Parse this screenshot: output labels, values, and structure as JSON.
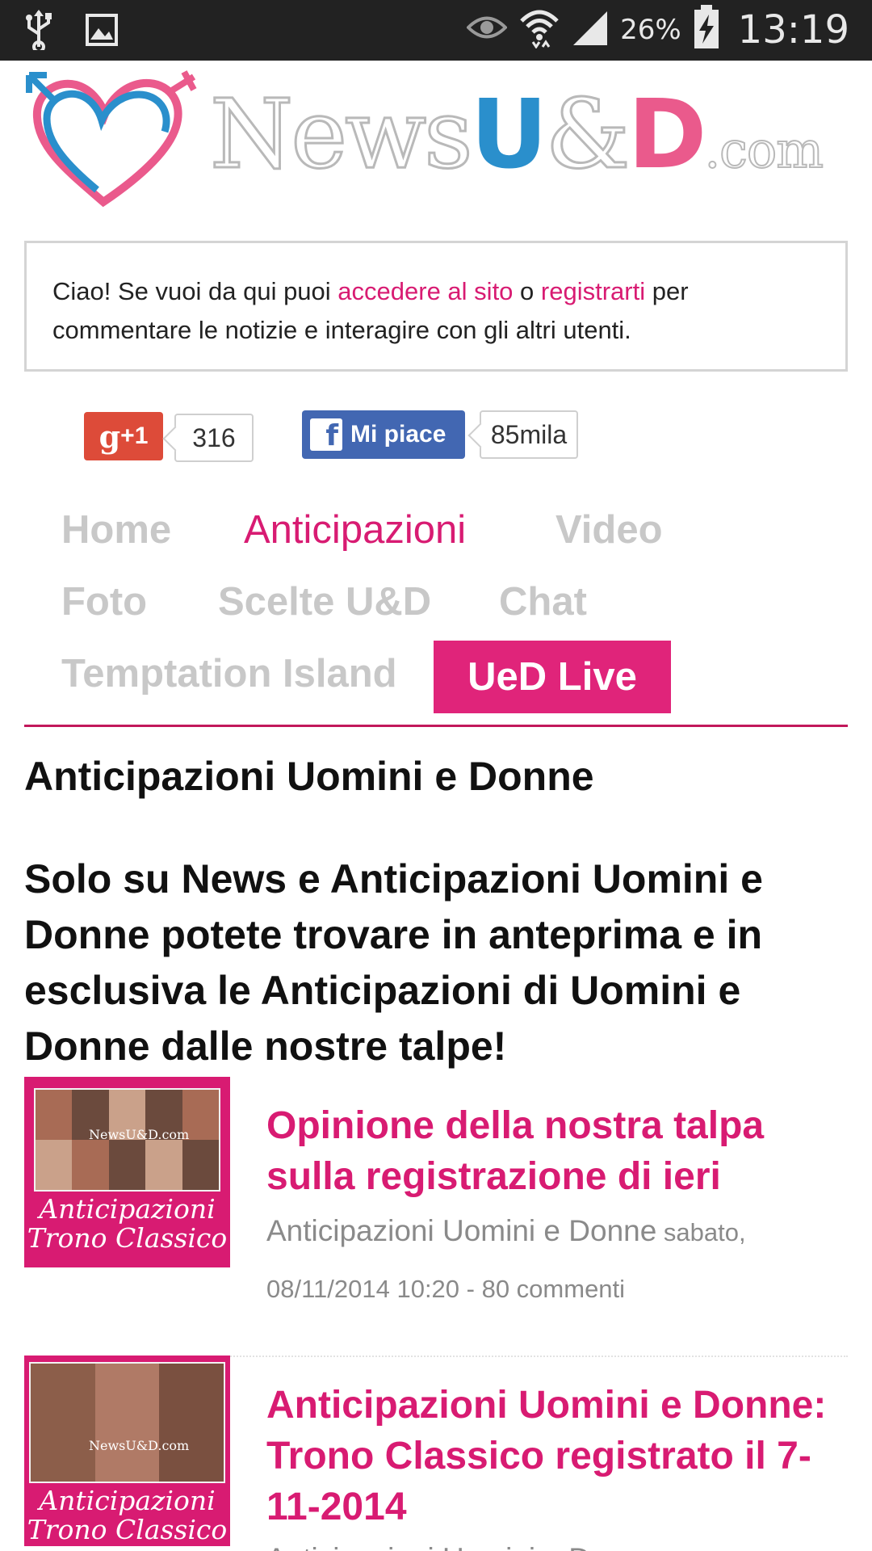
{
  "status_bar": {
    "battery_percent": "26%",
    "time": "13:19"
  },
  "logo": {
    "part_news": "News",
    "part_u": "U",
    "part_amp": "&",
    "part_d": "D",
    "part_com": ".com"
  },
  "notice": {
    "text_before": "Ciao! Se vuoi da qui puoi ",
    "login_link": "accedere al sito",
    "text_middle": " o ",
    "register_link": "registrarti",
    "text_after": " per commentare le notizie e interagire con gli altri utenti."
  },
  "social": {
    "gplus_label": "+1",
    "gplus_g": "g",
    "gplus_count": "316",
    "fb_label": "Mi piace",
    "fb_icon": "f",
    "fb_count": "85mila"
  },
  "nav": {
    "items": [
      {
        "label": "Home"
      },
      {
        "label": "Anticipazioni"
      },
      {
        "label": "Video"
      },
      {
        "label": "Foto"
      },
      {
        "label": "Scelte U&D"
      },
      {
        "label": "Chat"
      },
      {
        "label": "Temptation Island"
      },
      {
        "label": "UeD Live"
      }
    ],
    "active_index": 1
  },
  "page": {
    "title": "Anticipazioni Uomini e Donne",
    "intro": "Solo su News e Anticipazioni Uomini e Donne potete trovare in anteprima e in esclusiva le Anticipazioni di Uomini e Donne dalle nostre talpe!"
  },
  "articles": [
    {
      "title": "Opinione della nostra talpa sulla registrazione di ieri",
      "category": "Anticipazioni Uomini e Donne",
      "date": " sabato, 08/11/2014 10:20 - 80 commenti",
      "thumb_caption_1": "Anticipazioni",
      "thumb_caption_2": "Trono Classico",
      "thumb_brand": "NewsU&D.com"
    },
    {
      "title": "Anticipazioni Uomini e Donne: Trono Classico registrato il 7-11-2014",
      "category": "Anticipazioni Uomini e Donne",
      "thumb_caption_1": "Anticipazioni",
      "thumb_caption_2": "Trono Classico",
      "thumb_brand": "NewsU&D.com"
    }
  ],
  "colors": {
    "brand_pink": "#d81b72",
    "live_bg": "#e0247a",
    "nav_inactive": "#c8c8c8",
    "logo_blue": "#2a8fcc",
    "logo_pink": "#ea5a8c",
    "gplus_red": "#dd4b39",
    "fb_blue": "#4267b2",
    "status_bar_bg": "#222222"
  },
  "icons": [
    "usb-icon",
    "image-icon",
    "eye-icon",
    "wifi-icon",
    "signal-icon",
    "battery-charging-icon",
    "heart-gender-icon"
  ]
}
